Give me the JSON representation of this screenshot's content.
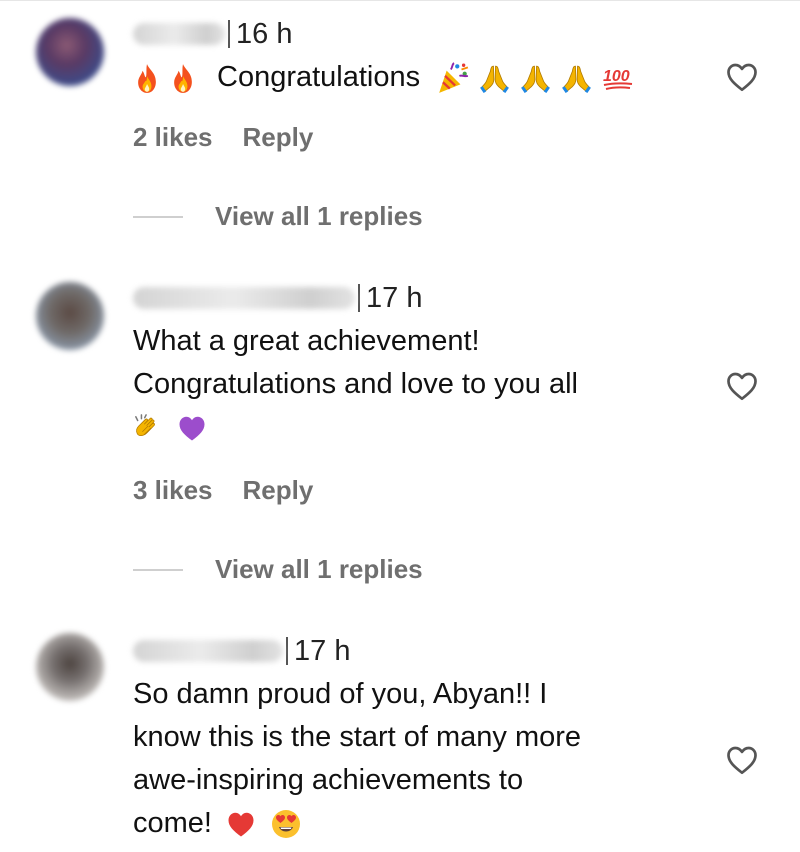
{
  "comments": [
    {
      "time": "16 h",
      "lines": [
        "Congratulations"
      ],
      "likes": "2 likes",
      "reply": "Reply",
      "view_replies": "View all 1 replies"
    },
    {
      "time": "17 h",
      "lines": [
        "What a great achievement!",
        "Congratulations and love to you all"
      ],
      "likes": "3 likes",
      "reply": "Reply",
      "view_replies": "View all 1 replies"
    },
    {
      "time": "17 h",
      "lines": [
        "So damn proud of you, Abyan!! I",
        "know this is the start of many more",
        "awe-inspiring achievements to",
        "come!"
      ]
    }
  ],
  "icons": {
    "like": "heart-outline-icon",
    "emoji": [
      "fire-emoji",
      "party-popper-emoji",
      "folded-hands-emoji",
      "hundred-points-emoji",
      "clapping-hands-emoji",
      "purple-heart-emoji",
      "red-heart-emoji",
      "heart-eyes-emoji"
    ]
  },
  "colors": {
    "text": "#111111",
    "muted": "#6f6f6f",
    "divider": "#cfcfcf"
  }
}
